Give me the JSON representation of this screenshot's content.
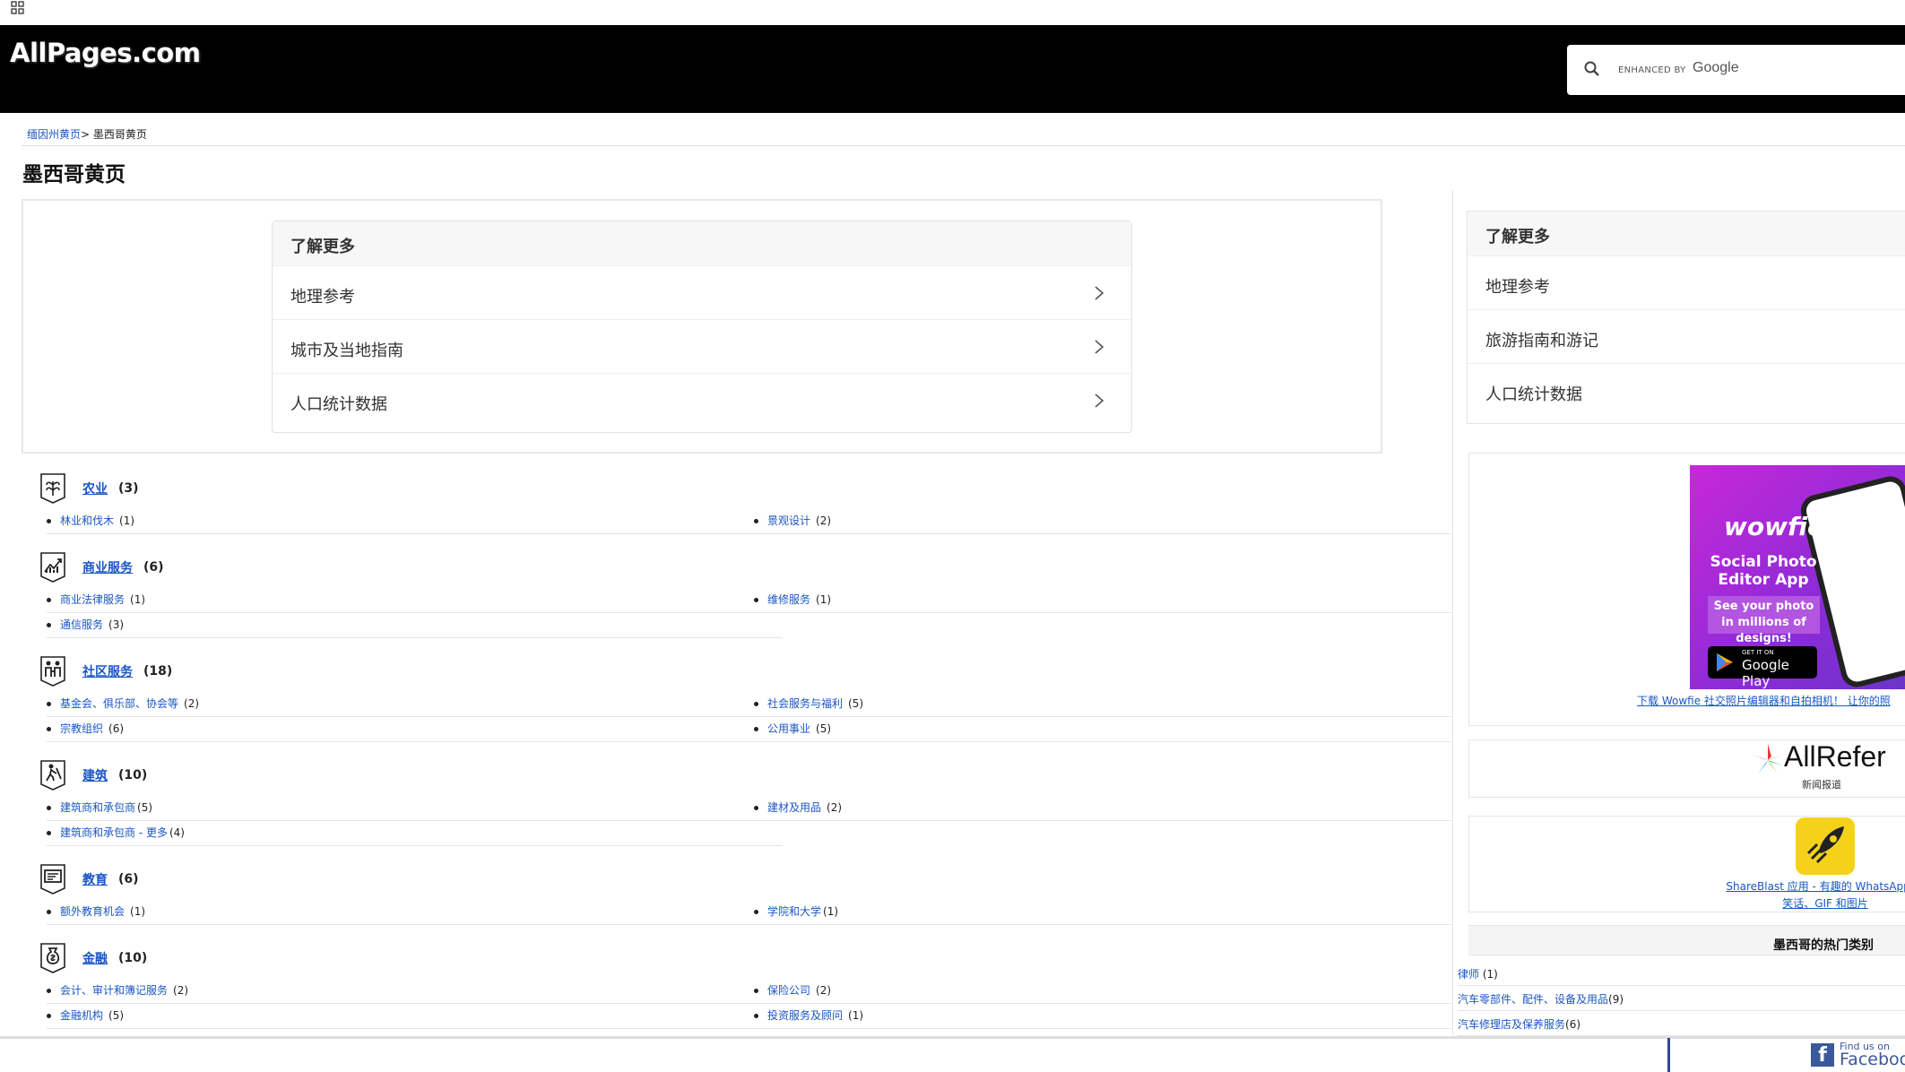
{
  "header": {
    "logo": "AllPages.com",
    "search_enhanced": "ENHANCED BY",
    "search_google": "Google"
  },
  "breadcrumb": {
    "parent": "缅因州黄页",
    "separator": "> ",
    "current": "墨西哥黄页"
  },
  "page_title": "墨西哥黄页",
  "learn_more": {
    "title": "了解更多",
    "items": [
      "地理参考",
      "城市及当地指南",
      "人口统计数据"
    ]
  },
  "side_learn_more": {
    "title": "了解更多",
    "items": [
      "地理参考",
      "旅游指南和游记",
      "人口统计数据"
    ]
  },
  "categories": [
    {
      "name": "农业",
      "count": "(3)",
      "icon": "plant-icon",
      "subs": [
        {
          "name": "林业和伐木",
          "count": "(1)"
        },
        {
          "name": "景观设计",
          "count": "(2)"
        }
      ]
    },
    {
      "name": "商业服务",
      "count": "(6)",
      "icon": "chart-icon",
      "subs": [
        {
          "name": "商业法律服务",
          "count": "(1)"
        },
        {
          "name": "维修服务",
          "count": "(1)"
        },
        {
          "name": "通信服务",
          "count": "(3)"
        }
      ]
    },
    {
      "name": "社区服务",
      "count": "(18)",
      "icon": "people-icon",
      "subs": [
        {
          "name": "基金会、俱乐部、协会等",
          "count": "(2)"
        },
        {
          "name": "社会服务与福利",
          "count": "(5)"
        },
        {
          "name": "宗教组织",
          "count": "(6)"
        },
        {
          "name": "公用事业",
          "count": "(5)"
        }
      ]
    },
    {
      "name": "建筑",
      "count": "(10)",
      "icon": "construction-icon",
      "subs": [
        {
          "name": "建筑商和承包商",
          "count": "(5)"
        },
        {
          "name": "建材及用品",
          "count": "(2)"
        },
        {
          "name": "建筑商和承包商 - 更多",
          "count": "(4)"
        }
      ]
    },
    {
      "name": "教育",
      "count": "(6)",
      "icon": "education-icon",
      "subs": [
        {
          "name": "额外教育机会",
          "count": "(1)"
        },
        {
          "name": "学院和大学",
          "count": "(1)"
        }
      ]
    },
    {
      "name": "金融",
      "count": "(10)",
      "icon": "money-bag-icon",
      "subs": [
        {
          "name": "会计、审计和簿记服务",
          "count": "(2)"
        },
        {
          "name": "保险公司",
          "count": "(2)"
        },
        {
          "name": "金融机构",
          "count": "(5)"
        },
        {
          "name": "投资服务及顾问",
          "count": "(1)"
        }
      ]
    }
  ],
  "ads": {
    "wowfie": {
      "brand": "wowfie",
      "headline": "Social Photo Editor App",
      "tagline": "See your photo in millions of designs!",
      "store_small": "GET IT ON",
      "store_big": "Google Play",
      "link": "下载 Wowfie 社交照片编辑器和自拍相机！ 让你的照"
    },
    "allrefer": {
      "brand": "AllRefer",
      "sub": "新闻报道"
    },
    "shareblast": {
      "link_line1": "ShareBlast 应用 - 有趣的 WhatsApp 表",
      "link_line2": "笑话、GIF 和图片"
    }
  },
  "popular": {
    "title": "墨西哥的热门类别",
    "items": [
      {
        "name": "律师",
        "count": "(1)"
      },
      {
        "name": "汽车零部件、配件、设备及用品",
        "count": "(9)"
      },
      {
        "name": "汽车修理店及保养服务",
        "count": "(6)"
      }
    ]
  },
  "footer": {
    "fb_small": "Find us on",
    "fb_big": "Facebook"
  }
}
